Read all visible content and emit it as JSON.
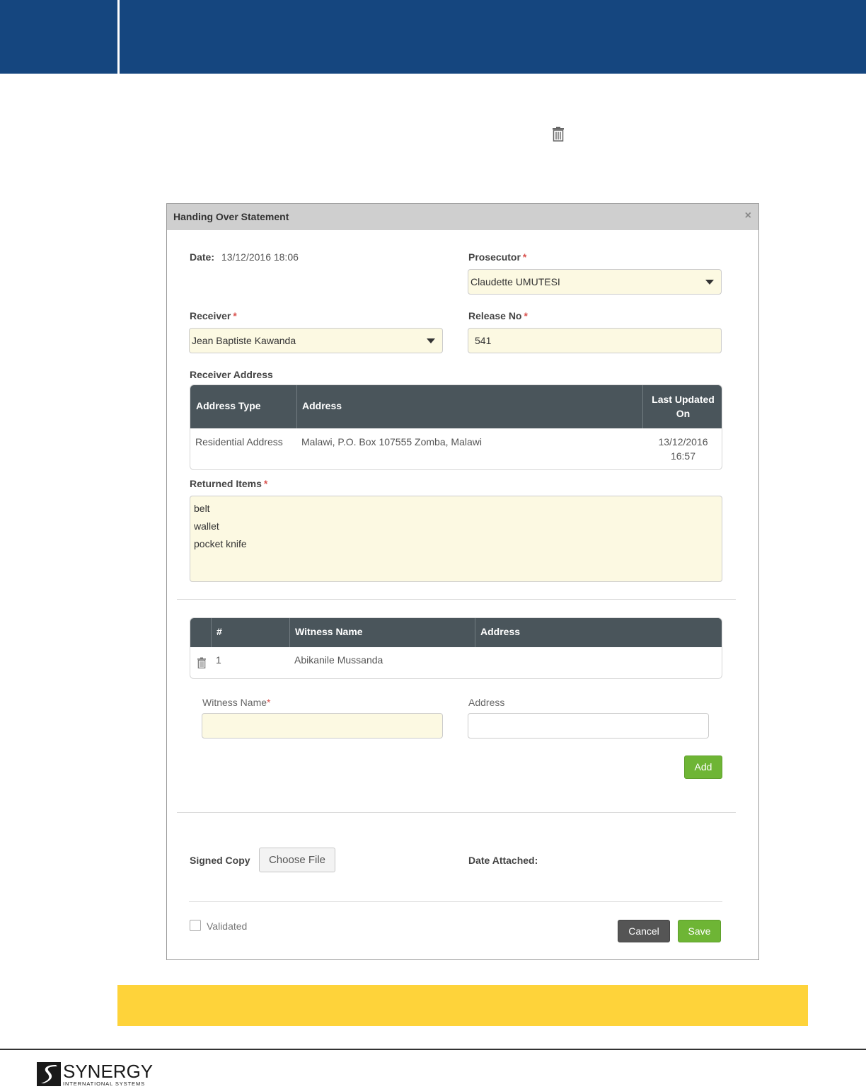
{
  "modal": {
    "title": "Handing Over Statement",
    "close_glyph": "×",
    "date_label": "Date:",
    "date_value": "13/12/2016 18:06",
    "prosecutor_label": "Prosecutor",
    "prosecutor_value": "Claudette UMUTESI",
    "receiver_label": "Receiver",
    "receiver_value": "Jean Baptiste Kawanda",
    "release_label": "Release No",
    "release_value": "541",
    "required_mark": "*",
    "receiver_address_label": "Receiver Address",
    "address_table": {
      "headers": [
        "Address Type",
        "Address",
        "Last Updated",
        "On"
      ],
      "rows": [
        {
          "type": "Residential Address",
          "address": "Malawi, P.O. Box 107555 Zomba, Malawi",
          "updated_date": "13/12/2016",
          "updated_time": "16:57"
        }
      ]
    },
    "returned_items_label": "Returned Items",
    "returned_items": [
      "belt",
      "wallet",
      "pocket knife"
    ],
    "witness_table": {
      "headers": [
        "#",
        "Witness Name",
        "Address"
      ],
      "rows": [
        {
          "num": "1",
          "name": "Abikanile Mussanda",
          "address": ""
        }
      ]
    },
    "witness_name_label": "Witness Name",
    "witness_address_label": "Address",
    "add_label": "Add",
    "signed_copy_label": "Signed Copy",
    "choose_file_label": "Choose File",
    "date_attached_label": "Date Attached:",
    "validated_label": "Validated",
    "cancel_label": "Cancel",
    "save_label": "Save"
  },
  "brand": {
    "name": "SYNERGY",
    "tagline": "INTERNATIONAL SYSTEMS"
  },
  "colors": {
    "header_band": "#15467f",
    "grid_header": "#4a555b",
    "field_fill": "#fcf9e2",
    "button_green": "#6eb535",
    "button_dark": "#555555",
    "callout_band": "#fed33a",
    "required": "#d9534f"
  },
  "icons": {
    "delete": "trash-icon",
    "dropdown": "caret-down-icon",
    "close": "close-icon"
  }
}
